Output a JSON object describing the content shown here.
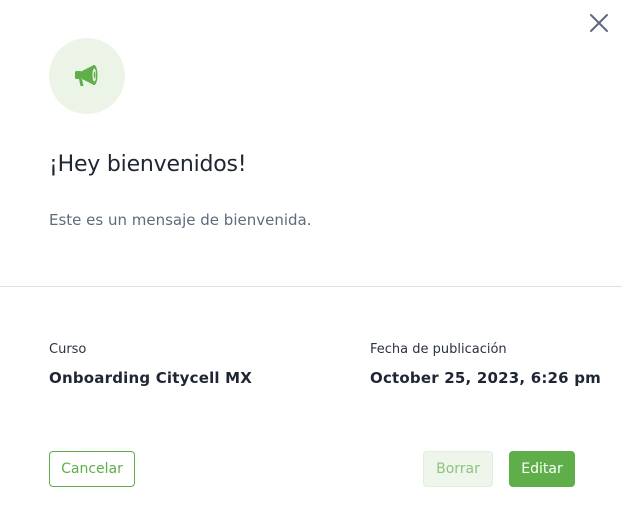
{
  "dialog": {
    "title": "¡Hey bienvenidos!",
    "message": "Este es un mensaje de bienvenida.",
    "icon": "megaphone-icon",
    "close_icon": "close-icon"
  },
  "details": {
    "course_label": "Curso",
    "course_value": "Onboarding Citycell MX",
    "date_label": "Fecha de publicación",
    "date_value": "October 25, 2023, 6:26 pm"
  },
  "actions": {
    "cancel_label": "Cancelar",
    "delete_label": "Borrar",
    "edit_label": "Editar"
  },
  "colors": {
    "accent": "#5fae4a",
    "accent_light": "#ebf4e7",
    "title_text": "#1f2633",
    "muted_text": "#5f6b7c",
    "divider": "#dcdfe3"
  }
}
